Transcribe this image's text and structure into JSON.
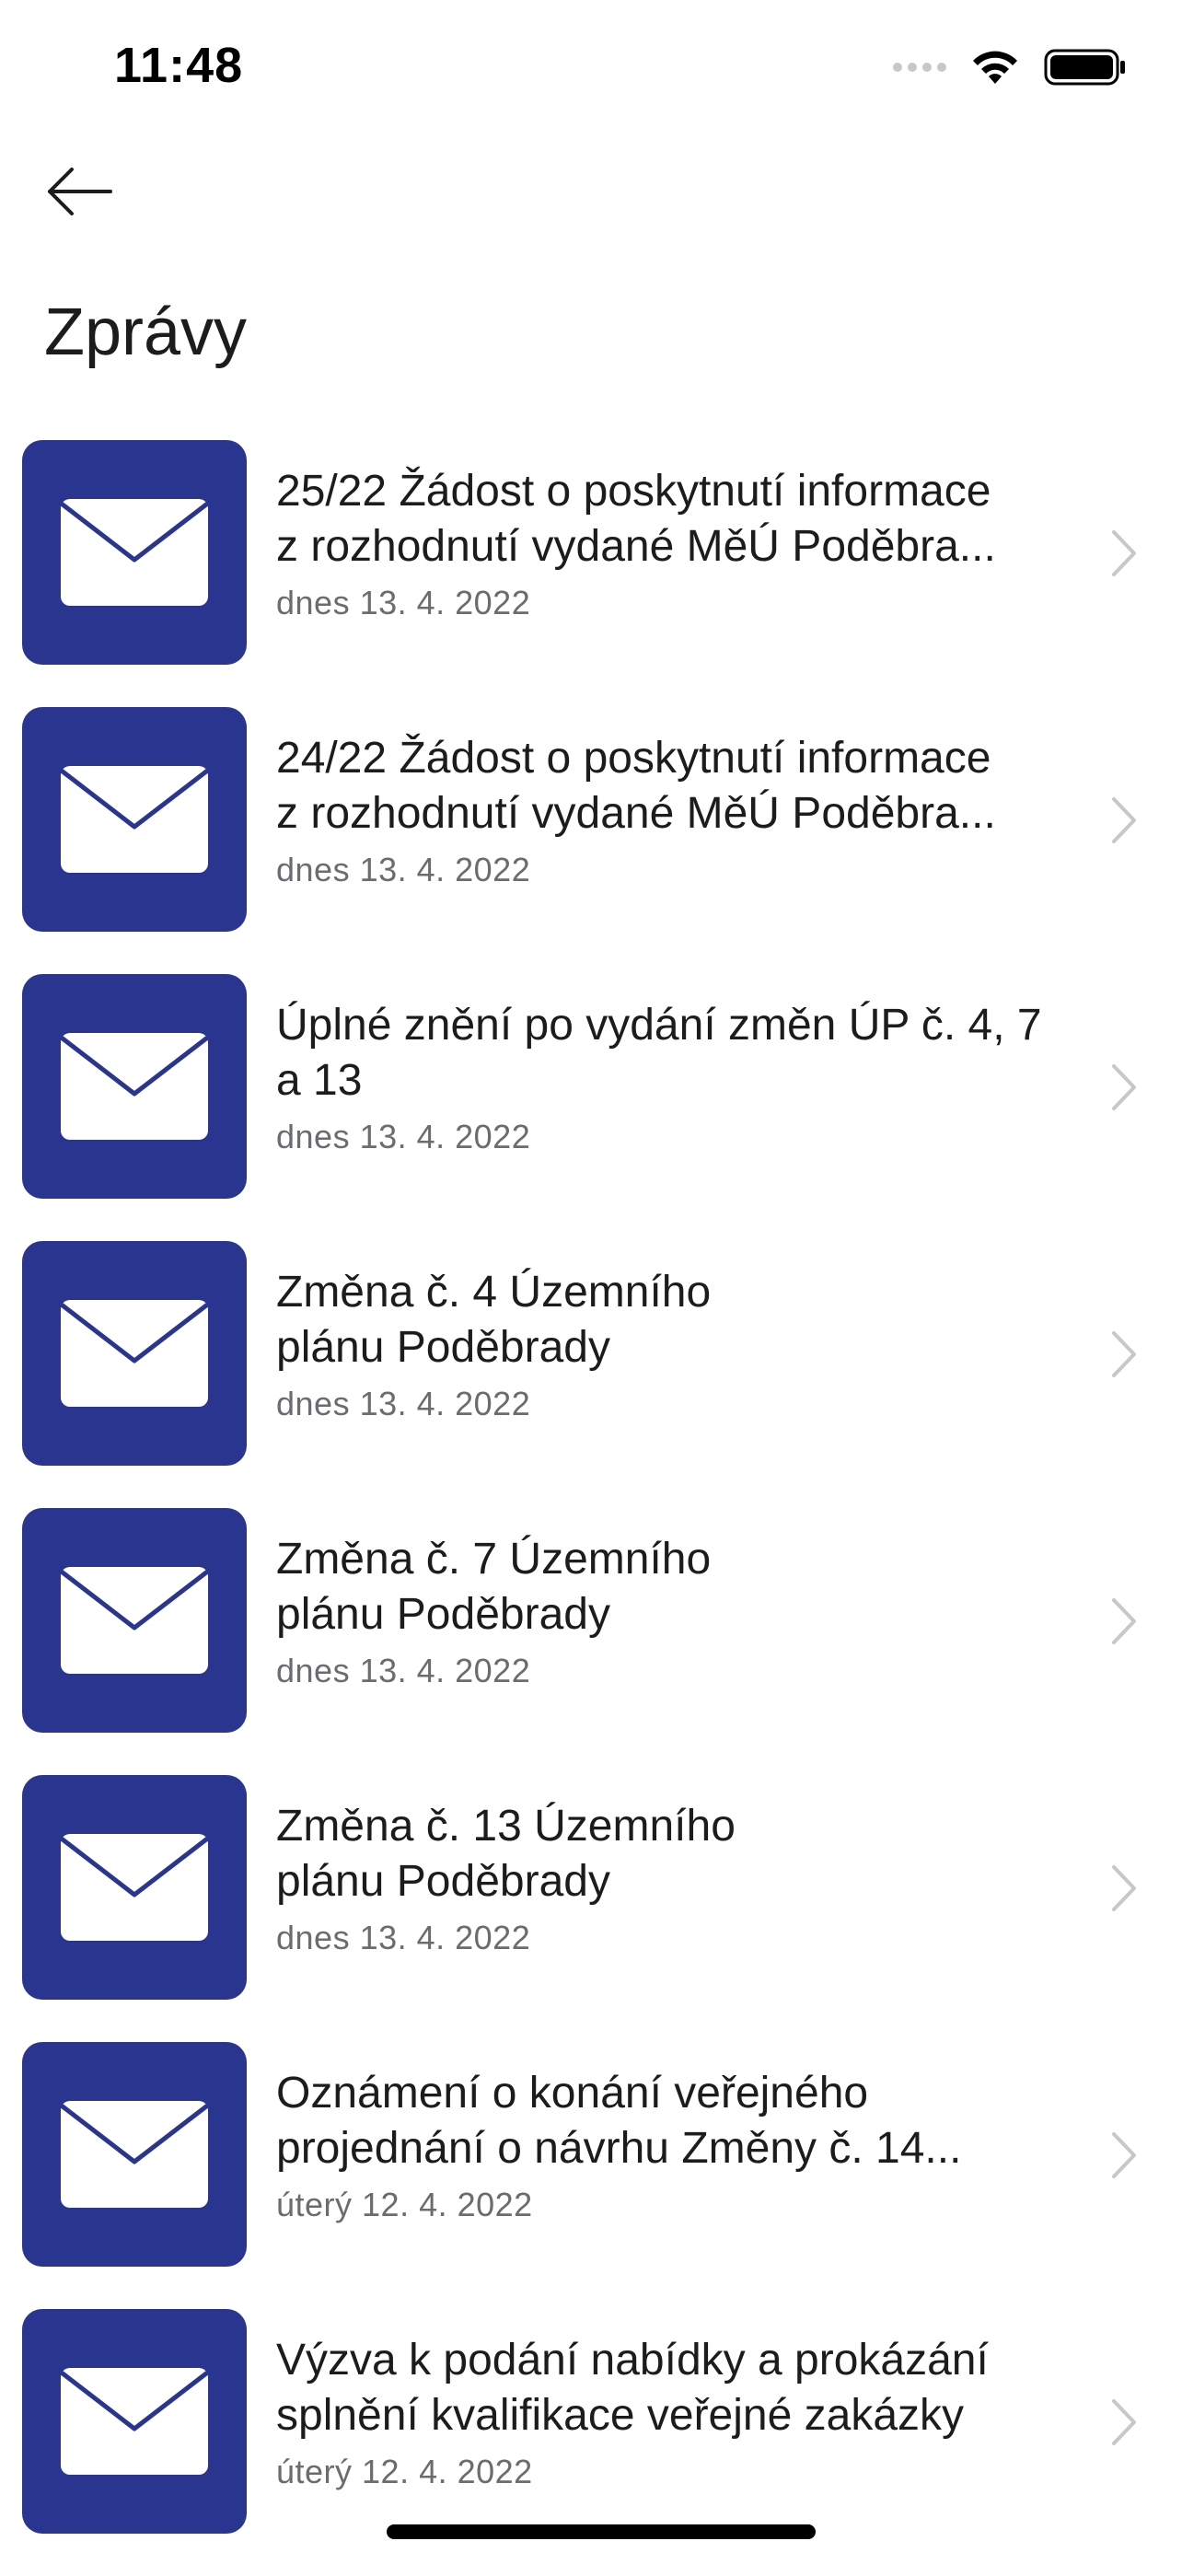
{
  "status_bar": {
    "time": "11:48"
  },
  "nav": {
    "back_icon": "arrow-left-icon"
  },
  "title": "Zprávy",
  "colors": {
    "icon_background": "#2a3590",
    "date_text": "#6b6b70",
    "chevron": "#c7c7cc"
  },
  "messages": [
    {
      "title_lines": [
        "25/22  Žádost o poskytnutí informace",
        "z rozhodnutí vydané MěÚ Poděbra..."
      ],
      "date": "dnes 13. 4. 2022",
      "icon": "envelope-icon"
    },
    {
      "title_lines": [
        "24/22  Žádost o poskytnutí informace",
        "z rozhodnutí vydané MěÚ Poděbra..."
      ],
      "date": "dnes 13. 4. 2022",
      "icon": "envelope-icon"
    },
    {
      "title_lines": [
        "Úplné znění po vydání změn ÚP č. 4, 7",
        "a 13"
      ],
      "date": "dnes 13. 4. 2022",
      "icon": "envelope-icon"
    },
    {
      "title_lines": [
        "Změna č. 4 Územního",
        "plánu Poděbrady"
      ],
      "date": "dnes 13. 4. 2022",
      "icon": "envelope-icon"
    },
    {
      "title_lines": [
        "Změna č. 7 Územního",
        "plánu Poděbrady"
      ],
      "date": "dnes 13. 4. 2022",
      "icon": "envelope-icon"
    },
    {
      "title_lines": [
        "Změna č. 13 Územního",
        "plánu Poděbrady"
      ],
      "date": "dnes 13. 4. 2022",
      "icon": "envelope-icon"
    },
    {
      "title_lines": [
        "Oznámení o konání veřejného",
        "projednání o návrhu Změny č. 14..."
      ],
      "date": "úterý 12. 4. 2022",
      "icon": "envelope-icon"
    },
    {
      "title_lines": [
        "Výzva k podání nabídky a prokázání",
        "splnění kvalifikace veřejné zakázky"
      ],
      "date": "úterý 12. 4. 2022",
      "icon": "envelope-icon"
    }
  ]
}
